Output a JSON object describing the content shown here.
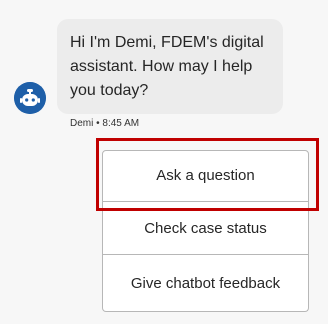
{
  "bot": {
    "avatar_icon": "robot-icon",
    "avatar_color": "#1e5fa8",
    "message": "Hi I'm Demi, FDEM's digital assistant. How may I help you today?",
    "sender_meta": "Demi • 8:45 AM"
  },
  "quick_replies": [
    {
      "label": "Ask a question",
      "highlighted": true
    },
    {
      "label": "Check case status",
      "highlighted": false
    },
    {
      "label": "Give chatbot feedback",
      "highlighted": false
    }
  ],
  "highlight_color": "#c00000"
}
